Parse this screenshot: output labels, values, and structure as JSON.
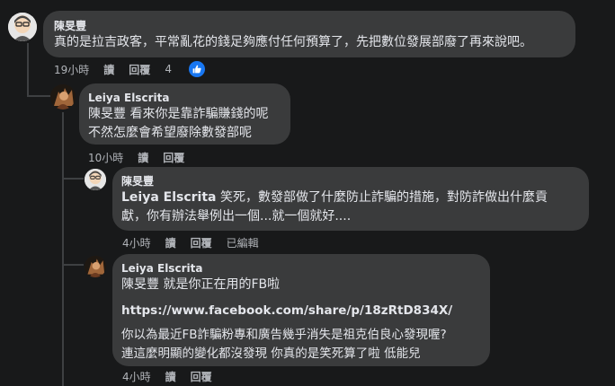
{
  "comments": [
    {
      "author": "陳旻豐",
      "text": "真的是拉吉政客，平常亂花的錢足夠應付任何預算了，先把數位發展部廢了再來說吧。",
      "time": "19小時",
      "reply": "讀",
      "respond": "回覆",
      "reactions": "4"
    },
    {
      "author": "Leiya Elscrita",
      "mention": "陳旻豐",
      "line1": "看來你是靠詐騙賺錢的呢",
      "line2": "不然怎麼會希望廢除數發部呢",
      "time": "10小時",
      "reply": "讀",
      "respond": "回覆"
    },
    {
      "author": "陳旻豐",
      "mention": "Leiya Elscrita",
      "line1": "笑死，數發部做了什麼防止詐騙的措施，對防詐做出什麼貢",
      "line2": "獻，你有辦法舉例出一個...就一個就好....",
      "time": "4小時",
      "reply": "讀",
      "respond": "回覆",
      "edited": "已編輯"
    },
    {
      "author": "Leiya Elscrita",
      "mention": "陳旻豐",
      "line1": "就是你正在用的FB啦",
      "link": "https://www.facebook.com/share/p/18zRtD834X/",
      "line2": "你以為最近FB詐騙粉專和廣告幾乎消失是祖克伯良心發現喔?",
      "line3": "連這麼明顯的變化都沒發現 你真的是笑死算了啦 低能兒",
      "time": "4小時",
      "reply": "讀",
      "respond": "回覆"
    }
  ],
  "colors": {
    "background": "#18191a",
    "bubble": "#3a3b3c",
    "like_blue": "#1877f2"
  }
}
